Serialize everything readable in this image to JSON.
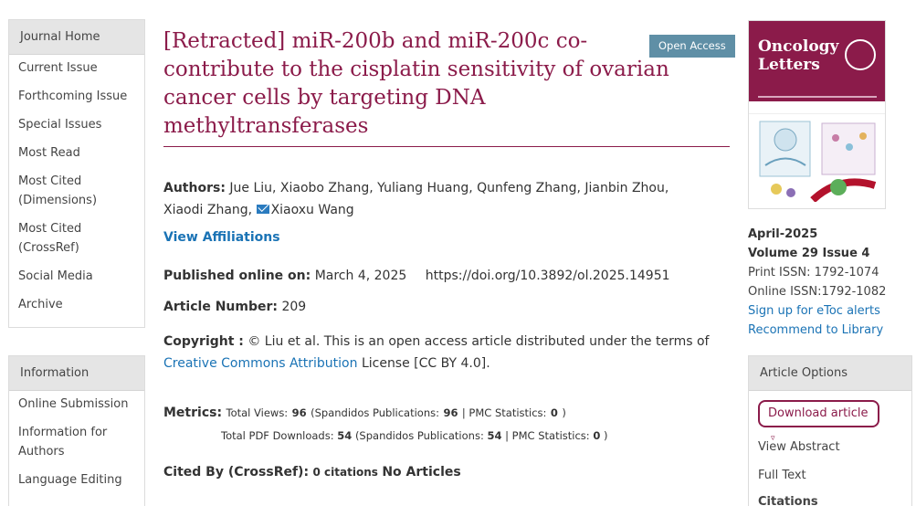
{
  "sidebar": {
    "journal_header": "Journal Home",
    "journal_items": [
      "Current Issue",
      "Forthcoming Issue",
      "Special Issues",
      "Most Read",
      "Most Cited (Dimensions)",
      "Most Cited (CrossRef)",
      "Social Media",
      "Archive"
    ],
    "info_header": "Information",
    "info_items": [
      "Online Submission",
      "Information for Authors",
      "Language Editing"
    ]
  },
  "article": {
    "title": "[Retracted] miR-200b and miR-200c co-contribute to the cisplatin sensitivity of ovarian cancer cells by targeting DNA methyltransferases",
    "badge": "Open Access",
    "authors_label": "Authors:",
    "authors": "Jue Liu, Xiaobo Zhang, Yuliang Huang, Qunfeng Zhang, Jianbin Zhou, Xiaodi Zhang,",
    "corresponding_author": "Xiaoxu Wang",
    "view_affiliations": "View Affiliations",
    "published_label": "Published online on:",
    "published_date": "March 4, 2025",
    "doi": "https://doi.org/10.3892/ol.2025.14951",
    "article_number_label": "Article Number:",
    "article_number": "209",
    "copyright_label": "Copyright :",
    "copyright_text": "© Liu et al. This is an open access article distributed under the terms of",
    "license_link": "Creative Commons Attribution",
    "license_suffix": "License [CC BY 4.0].",
    "metrics_label": "Metrics:",
    "total_views_label": "Total Views:",
    "total_views": "96",
    "spandidos_views_label": "(Spandidos Publications:",
    "spandidos_views": "96",
    "pmc_views_label": "| PMC Statistics:",
    "pmc_views": "0",
    "close_paren": ")",
    "total_pdf_label": "Total PDF Downloads:",
    "total_pdf": "54",
    "spandidos_pdf": "54",
    "pmc_pdf": "0",
    "citedby_label": "Cited By (CrossRef):",
    "citations_count": "0 citations",
    "no_articles": "No Articles"
  },
  "journal": {
    "cover_title": "Oncology Letters",
    "issue_date": "April-2025",
    "volume_issue": "Volume 29 Issue 4",
    "print_issn": "Print ISSN: 1792-1074",
    "online_issn": "Online ISSN:1792-1082",
    "etoc": "Sign up for eToc alerts",
    "recommend": "Recommend to Library"
  },
  "options": {
    "header": "Article Options",
    "download": "Download article",
    "view_abstract": "View Abstract",
    "full_text": "Full Text",
    "citations": "Citations"
  },
  "colors": {
    "brand": "#8b1b4a",
    "link": "#1a73b5",
    "badge": "#5f8fa6"
  }
}
